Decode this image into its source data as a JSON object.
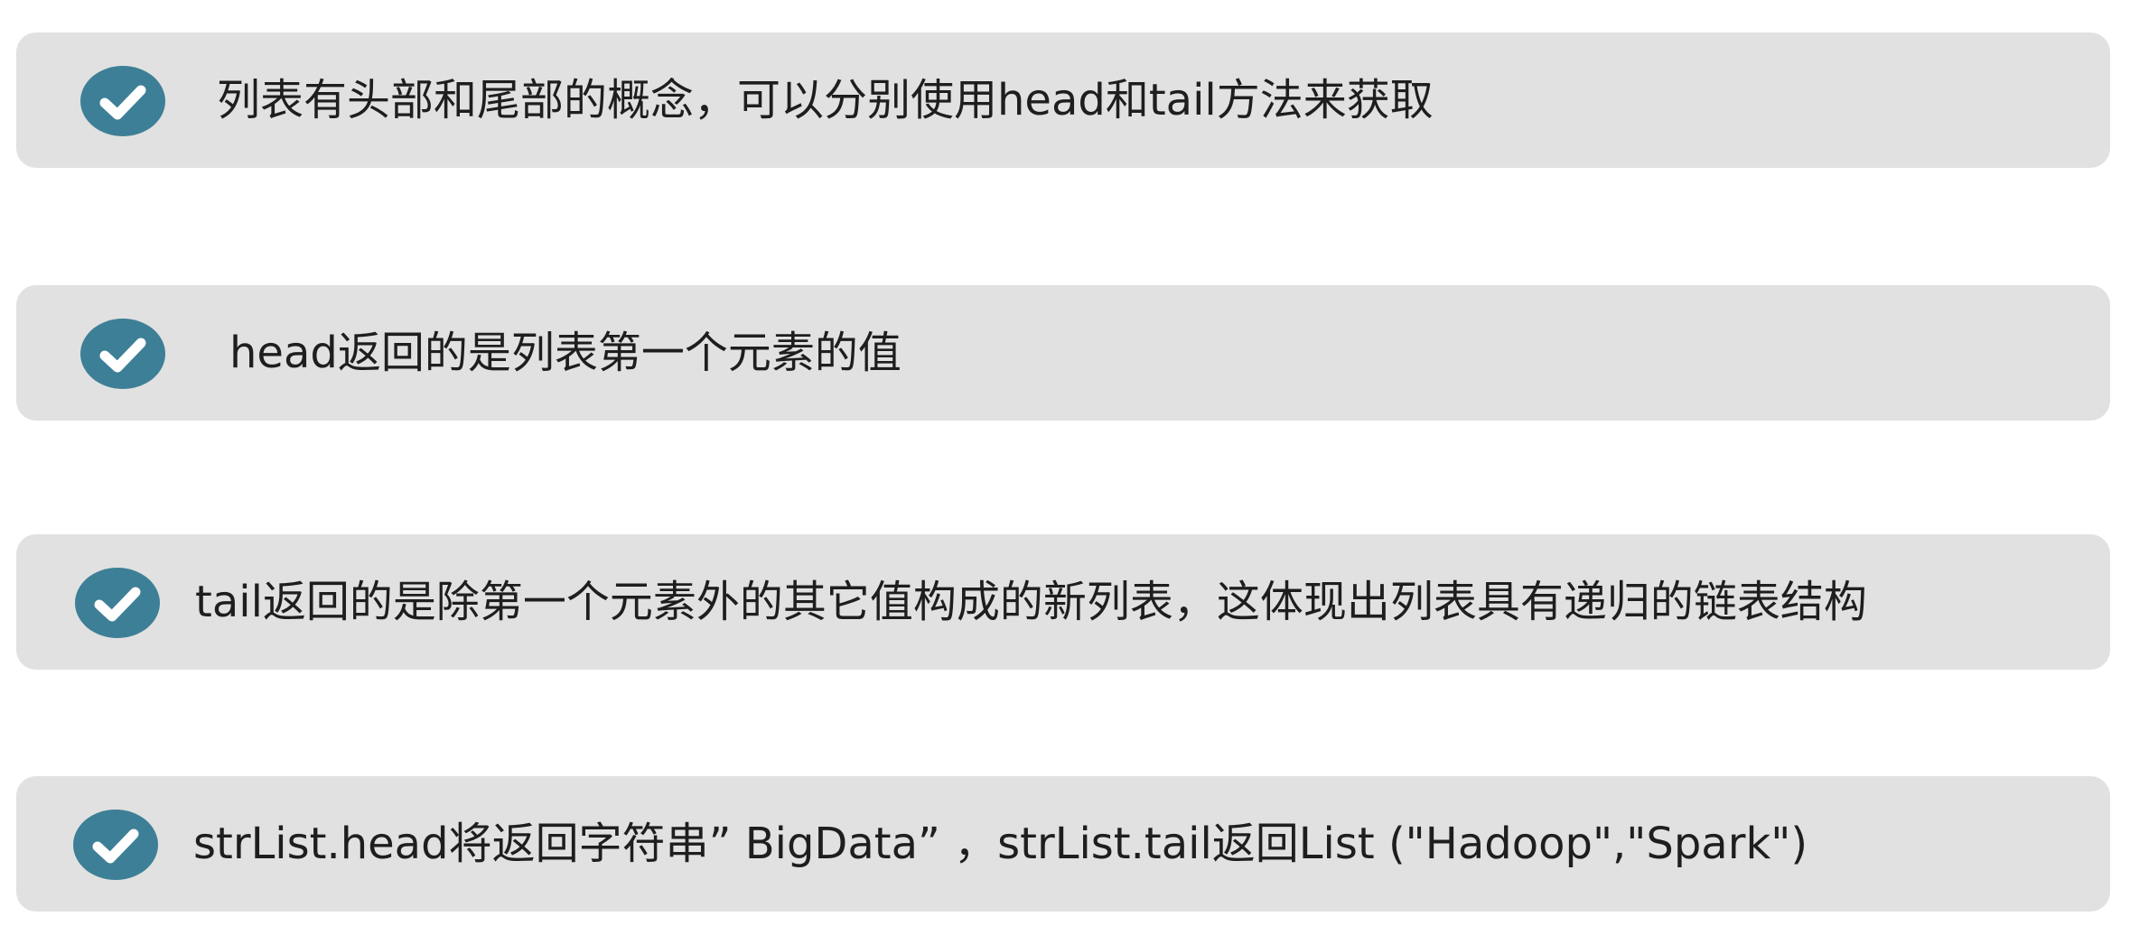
{
  "items": [
    {
      "icon": "check-circle-icon",
      "text": "列表有头部和尾部的概念，可以分别使用head和tail方法来获取"
    },
    {
      "icon": "check-circle-icon",
      "text": "head返回的是列表第一个元素的值"
    },
    {
      "icon": "check-circle-icon",
      "text": "tail返回的是除第一个元素外的其它值构成的新列表，这体现出列表具有递归的链表结构"
    },
    {
      "icon": "check-circle-icon",
      "text": "strList.head将返回字符串” BigData” ，strList.tail返回List (\"Hadoop\",\"Spark\")"
    }
  ],
  "colors": {
    "card_background": "#e1e1e1",
    "icon_fill": "#3d7f96",
    "icon_check": "#ffffff",
    "text": "#1e1e1e"
  }
}
